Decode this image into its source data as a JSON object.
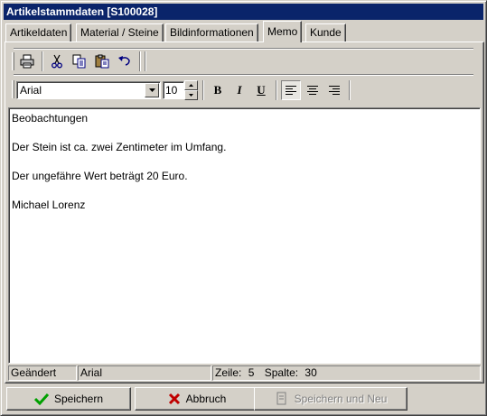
{
  "window": {
    "title": "Artikelstammdaten [S100028]"
  },
  "tabs": [
    {
      "label": "Artikeldaten"
    },
    {
      "label": "Material / Steine"
    },
    {
      "label": "Bildinformationen"
    },
    {
      "label": "Memo"
    },
    {
      "label": "Kunde"
    }
  ],
  "active_tab": "Memo",
  "toolbar": {
    "icons": [
      "print-icon",
      "cut-icon",
      "copy-icon",
      "paste-icon",
      "undo-icon"
    ],
    "font_name": "Arial",
    "font_size": "10",
    "format_buttons": {
      "bold": "B",
      "italic": "I",
      "underline": "U"
    }
  },
  "editor": {
    "lines": [
      "Beobachtungen",
      "Der Stein ist ca. zwei Zentimeter im Umfang.",
      "Der ungefähre Wert beträgt 20 Euro.",
      "Michael Lorenz"
    ]
  },
  "statusbar": {
    "state": "Geändert",
    "font": "Arial",
    "line_label": "Zeile:",
    "line_value": "5",
    "col_label": "Spalte:",
    "col_value": "30"
  },
  "buttons": {
    "save": "Speichern",
    "cancel": "Abbruch",
    "save_new": "Speichern und Neu"
  },
  "colors": {
    "titlebar": "#0a246a",
    "save_check": "#00a000",
    "cancel_x": "#c00000"
  }
}
